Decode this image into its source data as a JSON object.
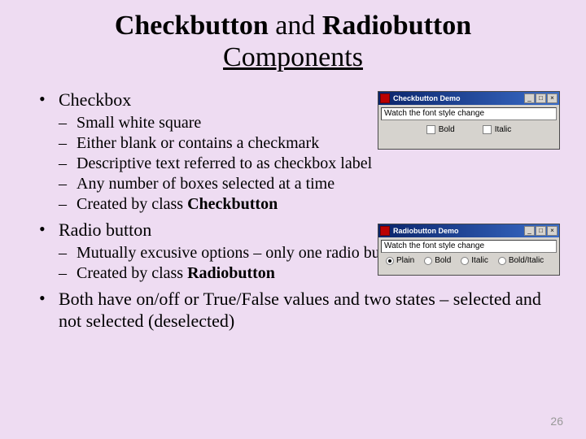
{
  "title": {
    "line1_bold1": "Checkbutton",
    "line1_plain": " and ",
    "line1_bold2": "Radiobutton",
    "line2": "Components"
  },
  "bullets": {
    "b1": "Checkbox",
    "b1_sub": [
      "Small white square",
      "Either blank or contains a checkmark",
      "Descriptive text referred to as checkbox label",
      "Any number of boxes selected at a time"
    ],
    "b1_sub5_pre": "Created by class ",
    "b1_sub5_bold": "Checkbutton",
    "b2": "Radio button",
    "b2_sub1": "Mutually excusive options – only one radio button selected at a time",
    "b2_sub2_pre": "Created by class ",
    "b2_sub2_bold": "Radiobutton",
    "b3": "Both have on/off or True/False values and two states – selected and not selected (deselected)"
  },
  "page_number": "26",
  "win1": {
    "title": "Checkbutton Demo",
    "text": "Watch the font style change",
    "opt1": "Bold",
    "opt2": "Italic"
  },
  "win2": {
    "title": "Radiobutton Demo",
    "text": "Watch the font style change",
    "r1": "Plain",
    "r2": "Bold",
    "r3": "Italic",
    "r4": "Bold/Italic"
  },
  "sym": {
    "min": "_",
    "max": "□",
    "close": "×"
  }
}
